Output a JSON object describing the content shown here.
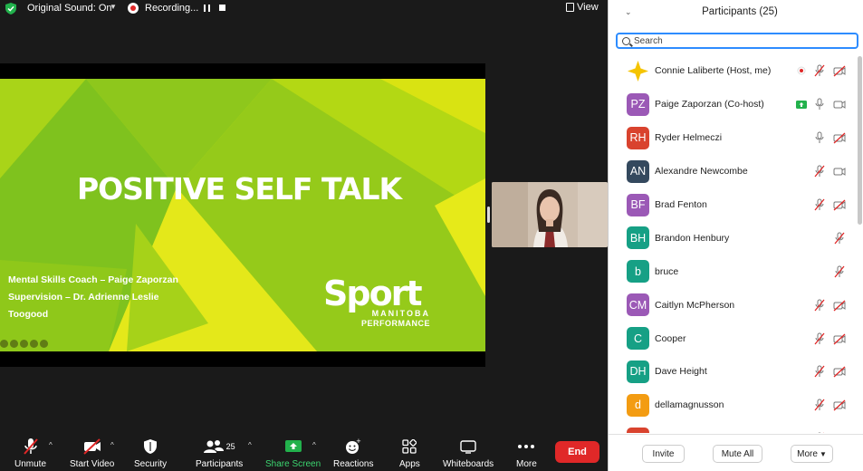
{
  "topbar": {
    "original_sound": "Original Sound: On",
    "recording": "Recording...",
    "view": "View"
  },
  "slide": {
    "title": "POSITIVE SELF TALK",
    "credit_line1": "Mental Skills Coach – Paige Zaporzan",
    "credit_line2": "Supervision – Dr. Adrienne Leslie",
    "credit_line3": "Toogood",
    "logo_word": "Sport",
    "logo_sub1": "MANITOBA",
    "logo_sub2": "PERFORMANCE",
    "bg_color": "#c8e010"
  },
  "toolbar": {
    "unmute": "Unmute",
    "start_video": "Start Video",
    "security": "Security",
    "participants": "Participants",
    "participants_count": "25",
    "share_screen": "Share Screen",
    "reactions": "Reactions",
    "apps": "Apps",
    "whiteboards": "Whiteboards",
    "more": "More",
    "end": "End"
  },
  "panel": {
    "title": "Participants (25)",
    "search_placeholder": "Search",
    "invite": "Invite",
    "mute_all": "Mute All",
    "more": "More"
  },
  "participants": [
    {
      "name": "Connie Laliberte (Host, me)",
      "initials": "",
      "color": "#f5c400",
      "icons": [
        "rec-dot",
        "mic-off",
        "video-off"
      ]
    },
    {
      "name": "Paige Zaporzan (Co-host)",
      "initials": "PZ",
      "color": "#9b59b6",
      "icons": [
        "share",
        "mic-on",
        "video-on"
      ]
    },
    {
      "name": "Ryder Helmeczi",
      "initials": "RH",
      "color": "#d9432e",
      "icons": [
        "mic-on",
        "video-off"
      ]
    },
    {
      "name": "Alexandre Newcombe",
      "initials": "AN",
      "color": "#34495e",
      "icons": [
        "mic-off",
        "video-on"
      ]
    },
    {
      "name": "Brad Fenton",
      "initials": "BF",
      "color": "#9b59b6",
      "icons": [
        "mic-off",
        "video-off"
      ]
    },
    {
      "name": "Brandon Henbury",
      "initials": "BH",
      "color": "#16a085",
      "icons": [
        "mic-off"
      ]
    },
    {
      "name": "bruce",
      "initials": "b",
      "color": "#16a085",
      "icons": [
        "mic-off"
      ]
    },
    {
      "name": "Caitlyn McPherson",
      "initials": "CM",
      "color": "#9b59b6",
      "icons": [
        "mic-off",
        "video-off"
      ]
    },
    {
      "name": "Cooper",
      "initials": "C",
      "color": "#16a085",
      "icons": [
        "mic-off",
        "video-off"
      ]
    },
    {
      "name": "Dave Height",
      "initials": "DH",
      "color": "#16a085",
      "icons": [
        "mic-off",
        "video-off"
      ]
    },
    {
      "name": "dellamagnusson",
      "initials": "d",
      "color": "#f39c12",
      "icons": [
        "mic-off",
        "video-off"
      ]
    },
    {
      "name": "",
      "initials": "",
      "color": "#d9432e",
      "icons": [
        "mic-off",
        "video-off"
      ]
    }
  ]
}
